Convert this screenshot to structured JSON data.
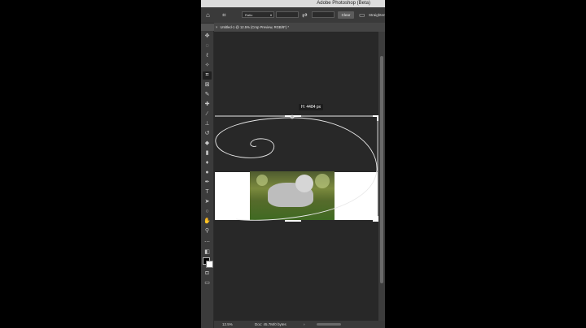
{
  "window": {
    "title": "Adobe Photoshop (Beta)"
  },
  "options_bar": {
    "ratio_label": "Ratio",
    "clear_label": "Clear",
    "straighten_label": "Straighten"
  },
  "document_tab": {
    "label": "Untitled-1 @ 12.5% (Crop Preview, RGB/8*) *"
  },
  "crop_tooltip": {
    "text": "H: 4484 px"
  },
  "status_bar": {
    "zoom": "12.5%",
    "doc_info": "Doc: 45.7M/0 bytes",
    "arrow": "›"
  },
  "colors": {
    "panel": "#535353",
    "canvas_bg": "#282828",
    "toolbar": "#3b3b3b"
  }
}
